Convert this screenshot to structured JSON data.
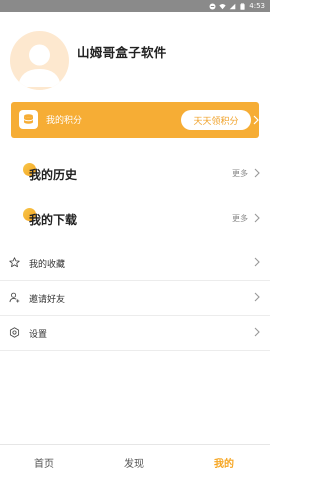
{
  "status_bar": {
    "time": "4:53",
    "icons": [
      "minus-circle-icon",
      "wifi-icon",
      "signal-icon",
      "battery-icon"
    ]
  },
  "profile": {
    "app_name": "山姆哥盒子软件"
  },
  "points": {
    "label": "我的积分",
    "button_label": "天天领积分"
  },
  "sections": {
    "history": {
      "title": "我的历史",
      "more": "更多"
    },
    "downloads": {
      "title": "我的下载",
      "more": "更多"
    }
  },
  "menu": [
    {
      "label": "我的收藏",
      "icon": "star-icon"
    },
    {
      "label": "邀请好友",
      "icon": "add-user-icon"
    },
    {
      "label": "设置",
      "icon": "gear-icon"
    }
  ],
  "tabs": [
    {
      "label": "首页"
    },
    {
      "label": "发现"
    },
    {
      "label": "我的",
      "active": true
    }
  ],
  "colors": {
    "accent": "#f6ad35",
    "status_bar": "#8a8a8a",
    "avatar_bg": "#fde8cf"
  }
}
